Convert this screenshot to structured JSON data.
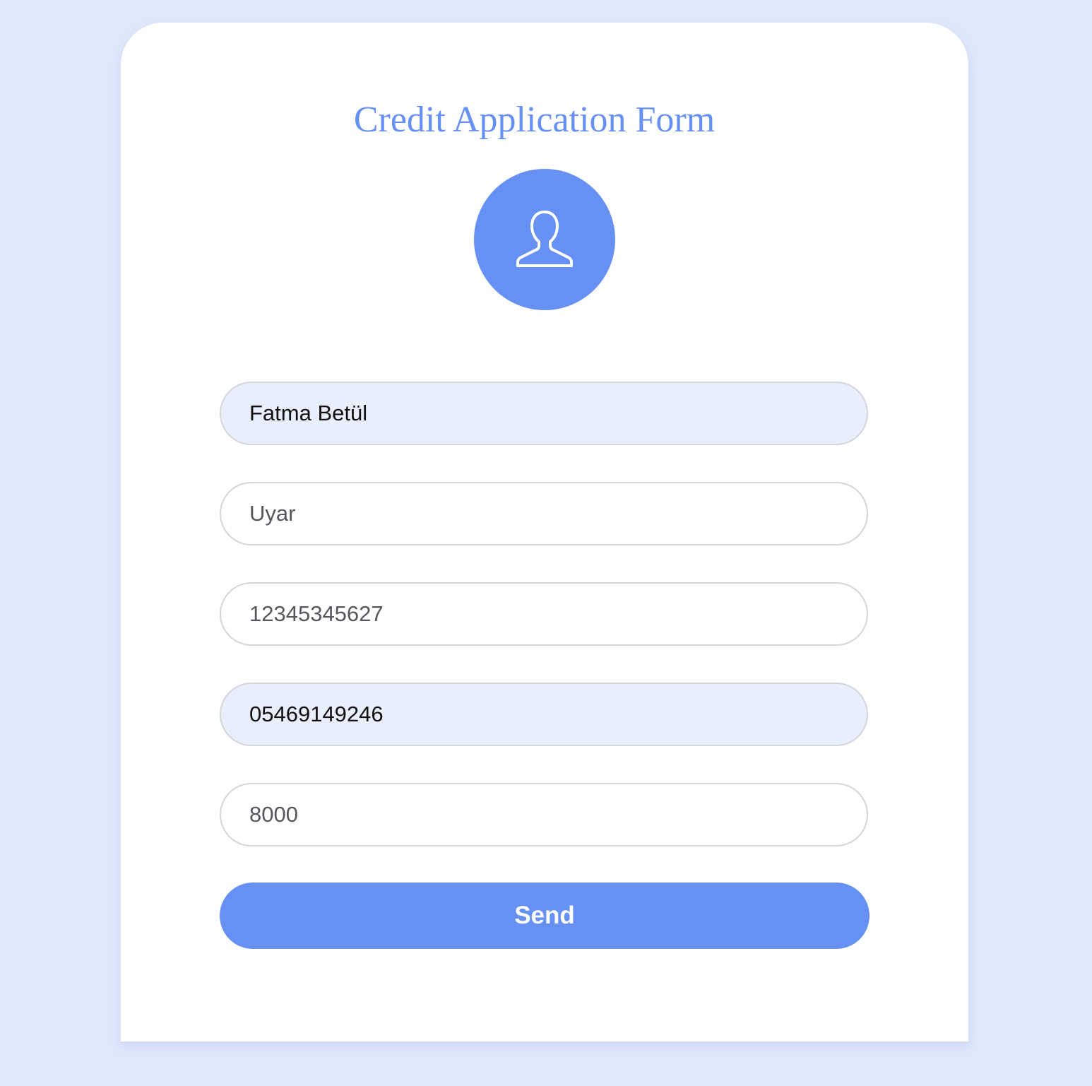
{
  "form": {
    "title": "Credit Application Form",
    "avatar_icon": "user-outline-icon",
    "accent_color": "#6690f4",
    "fields": [
      {
        "name": "first-name",
        "value": "Fatma Betül",
        "placeholder": "",
        "autofilled": true
      },
      {
        "name": "last-name",
        "value": "",
        "placeholder": "Uyar",
        "autofilled": false
      },
      {
        "name": "id-number",
        "value": "",
        "placeholder": "12345345627",
        "autofilled": false
      },
      {
        "name": "phone",
        "value": "05469149246",
        "placeholder": "",
        "autofilled": true
      },
      {
        "name": "amount",
        "value": "",
        "placeholder": "8000",
        "autofilled": false
      }
    ],
    "submit_label": "Send"
  }
}
